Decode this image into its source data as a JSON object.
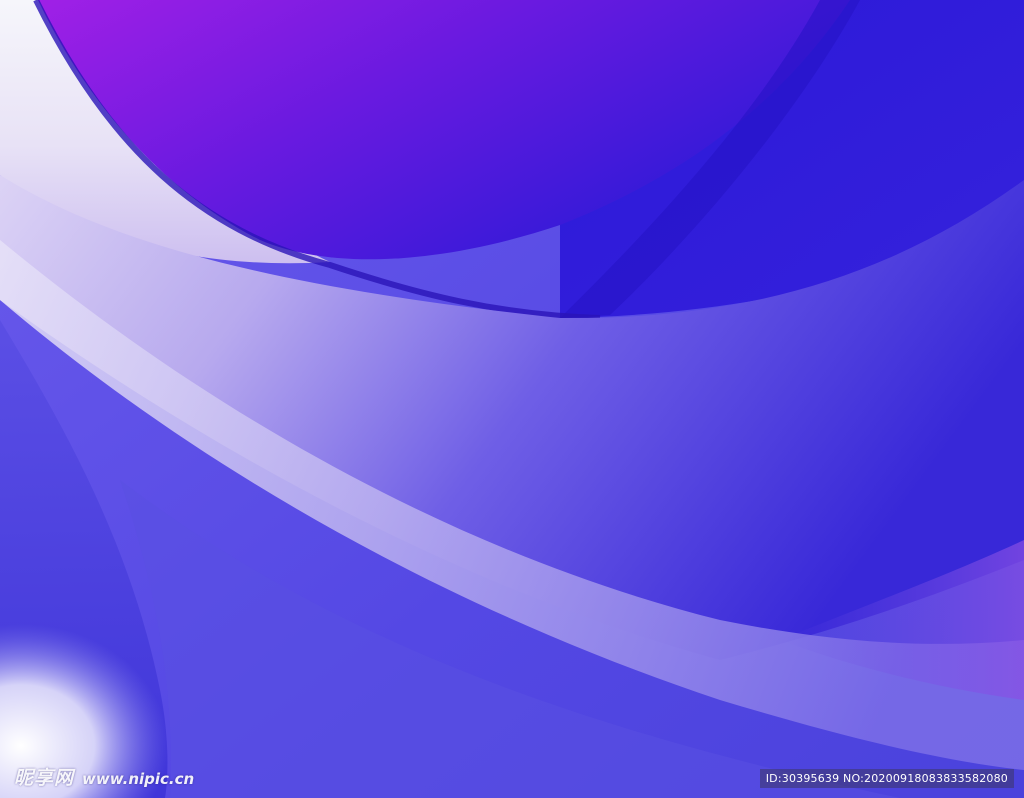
{
  "image": {
    "subject": "abstract-flowing-waves",
    "colors": {
      "deep_purple": "#9a1ee8",
      "royal_blue": "#2e1fd6",
      "violet_blue": "#5448e6",
      "lavender": "#c8b8f2",
      "pale_white": "#f2f0fb"
    }
  },
  "watermark": {
    "logo_text": "昵享网",
    "site_url": "www.nipic.cn",
    "id_text": "ID:30395639 NO:20200918083833582080"
  }
}
